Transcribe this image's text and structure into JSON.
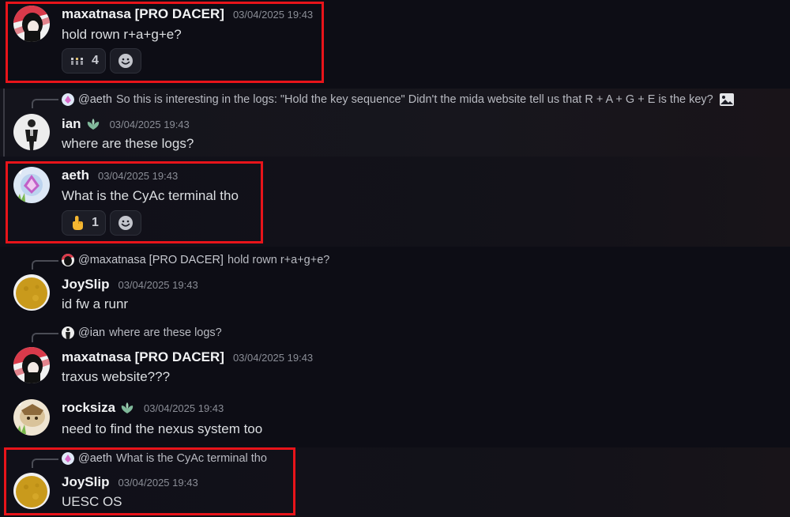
{
  "messages": [
    {
      "username": "maxatnasa [PRO DACER]",
      "timestamp": "03/04/2025 19:43",
      "content": "hold rown r+a+g+e?",
      "reactions": [
        {
          "emoji": "sparkle-eyes-emoji",
          "count": "4"
        }
      ]
    },
    {
      "reply": {
        "name": "@aeth",
        "text": "So this is interesting in the logs: \"Hold the key sequence\"  Didn't the mida website tell us that R + A + G + E is the key?"
      },
      "username": "ian",
      "timestamp": "03/04/2025 19:43",
      "content": "where are these logs?"
    },
    {
      "username": "aeth",
      "timestamp": "03/04/2025 19:43",
      "content": "What is the CyAc terminal tho",
      "reactions": [
        {
          "emoji": "pointing-up-emoji",
          "count": "1"
        }
      ]
    },
    {
      "reply": {
        "name": "@maxatnasa [PRO DACER]",
        "text": "hold rown r+a+g+e?"
      },
      "username": "JoySlip",
      "timestamp": "03/04/2025 19:43",
      "content": "id fw a runr"
    },
    {
      "reply": {
        "name": "@ian",
        "text": "where are these logs?"
      },
      "username": "maxatnasa [PRO DACER]",
      "timestamp": "03/04/2025 19:43",
      "content": "traxus website???"
    },
    {
      "username": "rocksiza",
      "timestamp": "03/04/2025 19:43",
      "content": "need to find the nexus system too"
    },
    {
      "reply": {
        "name": "@aeth",
        "text": "What is the CyAc terminal tho"
      },
      "username": "JoySlip",
      "timestamp": "03/04/2025 19:43",
      "content": "UESC OS"
    }
  ],
  "colors": {
    "background": "#0d0d15",
    "highlight_box": "#e8141a",
    "role_icon": "#7fb89a"
  }
}
